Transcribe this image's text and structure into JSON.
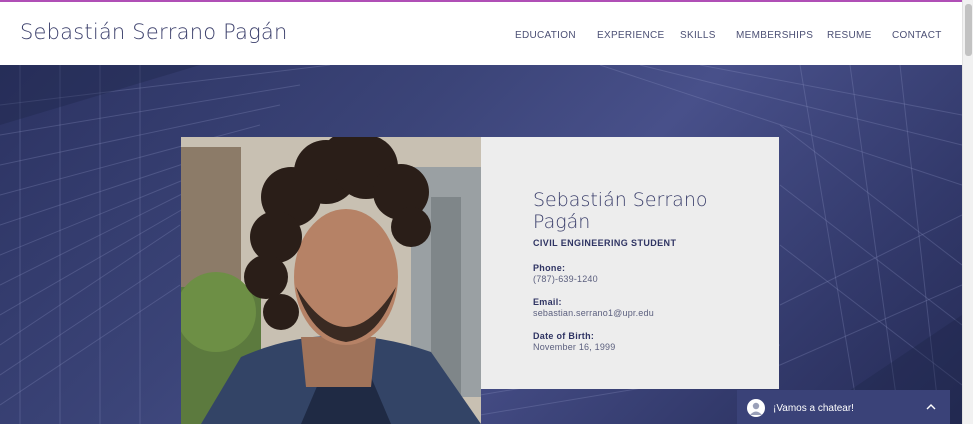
{
  "header": {
    "site_title": "Sebastián Serrano Pagán",
    "nav": [
      "EDUCATION",
      "EXPERIENCE",
      "SKILLS",
      "MEMBERSHIPS",
      "RESUME",
      "CONTACT"
    ]
  },
  "profile": {
    "name": "Sebastián Serrano Pagán",
    "role": "CIVIL ENGINEERING STUDENT",
    "phone_label": "Phone:",
    "phone": "(787)-639-1240",
    "email_label": "Email:",
    "email": "sebastian.serrano1@upr.edu",
    "dob_label": "Date of Birth:",
    "dob": "November 16, 1999"
  },
  "chat": {
    "label": "¡Vamos a chatear!",
    "avatar_icon": "user-icon",
    "toggle_icon": "chevron-up-icon"
  },
  "colors": {
    "accent_line": "#b04fb6",
    "brand_navy": "#3b3f6b",
    "hero_bg": "#3b4478",
    "card_bg": "#ededed",
    "chat_bg": "#3a4278"
  }
}
